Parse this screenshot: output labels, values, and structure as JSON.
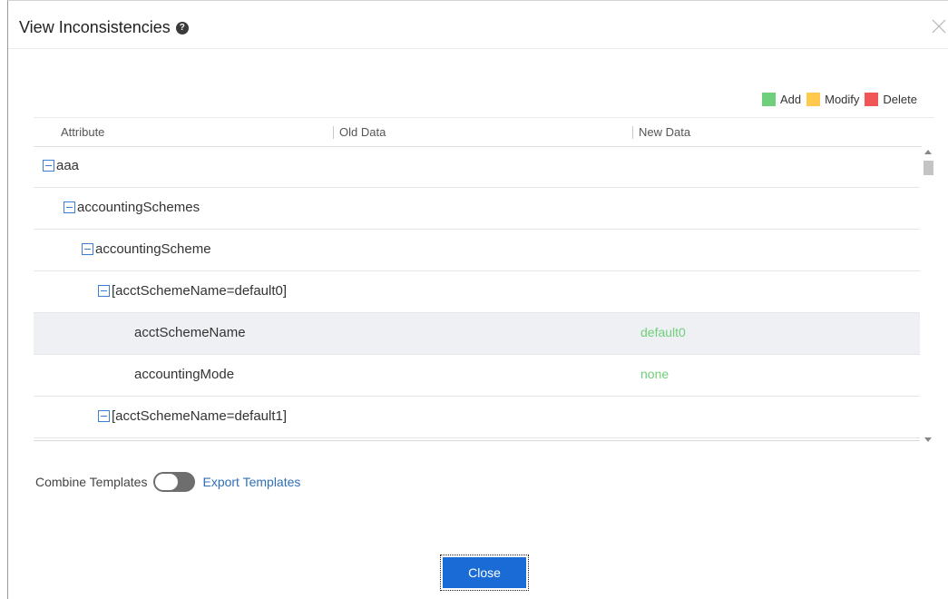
{
  "dialog": {
    "title": "View Inconsistencies",
    "help_icon": "?",
    "close_icon": "close-x-icon"
  },
  "legend": {
    "items": [
      {
        "label": "Add",
        "color": "#6fcf7a"
      },
      {
        "label": "Modify",
        "color": "#ffc94d"
      },
      {
        "label": "Delete",
        "color": "#f05656"
      }
    ]
  },
  "table": {
    "columns": {
      "attribute": "Attribute",
      "old": "Old Data",
      "new": "New Data"
    },
    "rows": [
      {
        "label": "aaa",
        "level": 0,
        "expandable": true,
        "new": ""
      },
      {
        "label": "accountingSchemes",
        "level": 1,
        "expandable": true,
        "new": ""
      },
      {
        "label": "accountingScheme",
        "level": 2,
        "expandable": true,
        "new": ""
      },
      {
        "label": "[acctSchemeName=default0]",
        "level": 3,
        "expandable": true,
        "new": ""
      },
      {
        "label": "acctSchemeName",
        "level": 4,
        "expandable": false,
        "new": "default0",
        "selected": true
      },
      {
        "label": "accountingMode",
        "level": 4,
        "expandable": false,
        "new": "none"
      },
      {
        "label": "[acctSchemeName=default1]",
        "level": 3,
        "expandable": true,
        "new": ""
      }
    ]
  },
  "footer": {
    "combine_label": "Combine Templates",
    "combine_on": false,
    "export_label": "Export Templates",
    "close_label": "Close"
  }
}
